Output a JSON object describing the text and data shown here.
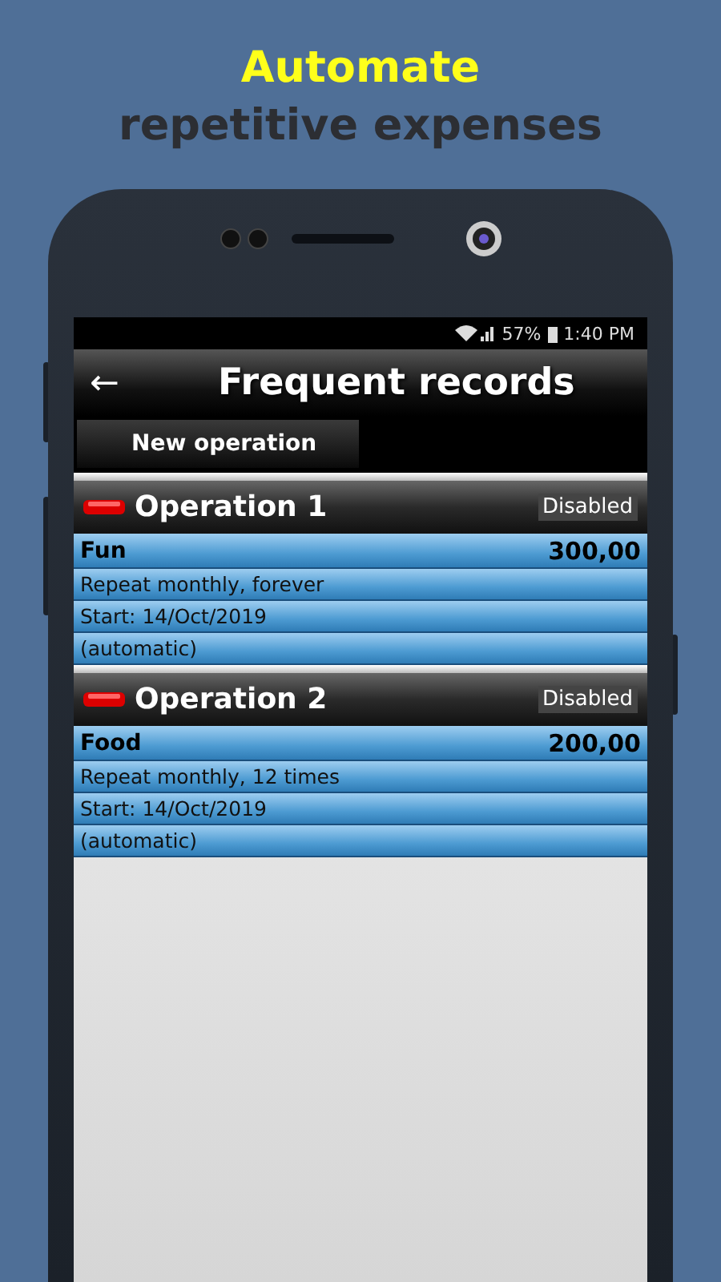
{
  "headline": {
    "highlight": "Automate",
    "rest": "repetitive expenses"
  },
  "status_bar": {
    "battery": "57%",
    "time": "1:40 PM"
  },
  "app_bar": {
    "back": "←",
    "title": "Frequent records"
  },
  "new_operation_button": "New operation",
  "operations": [
    {
      "title": "Operation 1",
      "status": "Disabled",
      "category": "Fun",
      "amount": "300,00",
      "repeat": "Repeat monthly, forever",
      "start": "Start: 14/Oct/2019",
      "mode": "(automatic)"
    },
    {
      "title": "Operation 2",
      "status": "Disabled",
      "category": "Food",
      "amount": "200,00",
      "repeat": "Repeat monthly, 12 times",
      "start": "Start: 14/Oct/2019",
      "mode": "(automatic)"
    }
  ]
}
